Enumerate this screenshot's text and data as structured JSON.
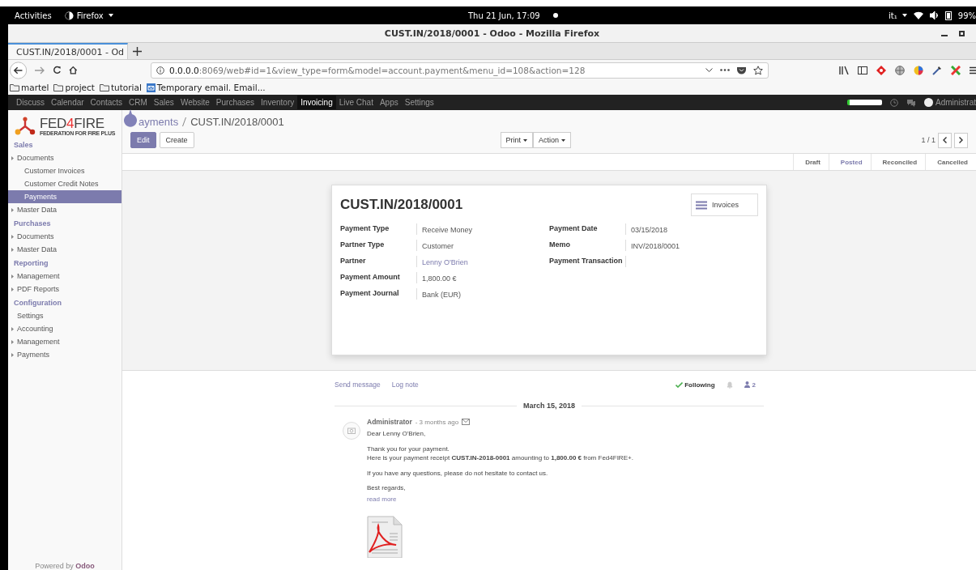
{
  "system_bar": {
    "activities": "Activities",
    "app_menu": "Firefox",
    "clock": "Thu 21 Jun, 17:09",
    "keyboard": "it₁",
    "battery": "99%"
  },
  "window": {
    "title": "CUST.IN/2018/0001 - Odoo - Mozilla Firefox"
  },
  "browser_tabs": [
    {
      "label": "CUST.IN/2018/0001 - Od",
      "selected": true
    }
  ],
  "address_bar": {
    "host": "0.0.0.0",
    "path": ":8069/web#id=1&view_type=form&model=account.payment&menu_id=108&action=128"
  },
  "bookmarks": [
    {
      "label": "martel",
      "kind": "folder"
    },
    {
      "label": "project",
      "kind": "folder"
    },
    {
      "label": "tutorial",
      "kind": "folder"
    },
    {
      "label": "Temporary email. Email...",
      "kind": "site"
    }
  ],
  "app_menu": [
    {
      "label": "Discuss",
      "selected": false
    },
    {
      "label": "Calendar",
      "selected": false
    },
    {
      "label": "Contacts",
      "selected": false
    },
    {
      "label": "CRM",
      "selected": false
    },
    {
      "label": "Sales",
      "selected": false
    },
    {
      "label": "Website",
      "selected": false
    },
    {
      "label": "Purchases",
      "selected": false
    },
    {
      "label": "Inventory",
      "selected": false
    },
    {
      "label": "Invoicing",
      "selected": true
    },
    {
      "label": "Live Chat",
      "selected": false
    },
    {
      "label": "Apps",
      "selected": false
    },
    {
      "label": "Settings",
      "selected": false
    }
  ],
  "user": {
    "name": "Administrat"
  },
  "sidebar": {
    "logo": {
      "name": "FED",
      "accent": "4",
      "rest": "FIRE",
      "tagline": "FEDERATION FOR FIRE PLUS"
    },
    "sections": [
      {
        "title": "Sales",
        "items": [
          {
            "label": "Documents",
            "kind": "folder",
            "children": [
              {
                "label": "Customer Invoices",
                "selected": false
              },
              {
                "label": "Customer Credit Notes",
                "selected": false
              },
              {
                "label": "Payments",
                "selected": true
              }
            ]
          },
          {
            "label": "Master Data",
            "kind": "folder"
          }
        ]
      },
      {
        "title": "Purchases",
        "items": [
          {
            "label": "Documents",
            "kind": "folder"
          },
          {
            "label": "Master Data",
            "kind": "folder"
          }
        ]
      },
      {
        "title": "Reporting",
        "items": [
          {
            "label": "Management",
            "kind": "folder"
          },
          {
            "label": "PDF Reports",
            "kind": "folder"
          }
        ]
      },
      {
        "title": "Configuration",
        "items": [
          {
            "label": "Settings",
            "kind": "action"
          },
          {
            "label": "Accounting",
            "kind": "folder"
          },
          {
            "label": "Management",
            "kind": "folder"
          },
          {
            "label": "Payments",
            "kind": "folder"
          }
        ]
      }
    ],
    "powered_by": "Powered by",
    "powered_link": "Odoo"
  },
  "breadcrumb": [
    "ayments",
    "CUST.IN/2018/0001"
  ],
  "buttons": [
    {
      "label": "Edit",
      "kind": "primary"
    },
    {
      "label": "Create",
      "kind": "secondary"
    }
  ],
  "dropdowns": [
    "Print",
    "Action"
  ],
  "pager": "1 / 1",
  "statuses": [
    {
      "label": "Draft",
      "selected": false
    },
    {
      "label": "Posted",
      "selected": true
    },
    {
      "label": "Reconciled",
      "selected": false
    },
    {
      "label": "Cancelled",
      "selected": false
    }
  ],
  "form": {
    "title": "CUST.IN/2018/0001",
    "smart_button": "Invoices",
    "left_fields": [
      {
        "label": "Payment Type",
        "value": "Receive Money",
        "kind": "text"
      },
      {
        "label": "Partner Type",
        "value": "Customer",
        "kind": "text"
      },
      {
        "label": "Partner",
        "value": "Lenny O'Brien",
        "kind": "link"
      },
      {
        "label": "Payment Amount",
        "value": "1,800.00 €",
        "kind": "text"
      },
      {
        "label": "Payment Journal",
        "value": "Bank (EUR)",
        "kind": "text"
      }
    ],
    "right_fields": [
      {
        "label": "Payment Date",
        "value": "03/15/2018",
        "kind": "text"
      },
      {
        "label": "Memo",
        "value": "INV/2018/0001",
        "kind": "text"
      },
      {
        "label": "Payment Transaction"
      }
    ]
  },
  "chatter": {
    "actions": [
      "Send message",
      "Log note"
    ],
    "following": "Following",
    "followers": "2",
    "date": "March 15, 2018",
    "message": {
      "author": "Administrator",
      "time": "- 3 months ago",
      "paragraphs": [
        "Dear Lenny O'Brien,",
        "Thank you for your payment.\nHere is your payment receipt **CUST.IN-2018-0001** amounting to **1,800.00 €** from Fed4FIRE+.",
        "If you have any questions, please do not hesitate to contact us.",
        "Best regards,"
      ],
      "read_more": "read more"
    }
  }
}
